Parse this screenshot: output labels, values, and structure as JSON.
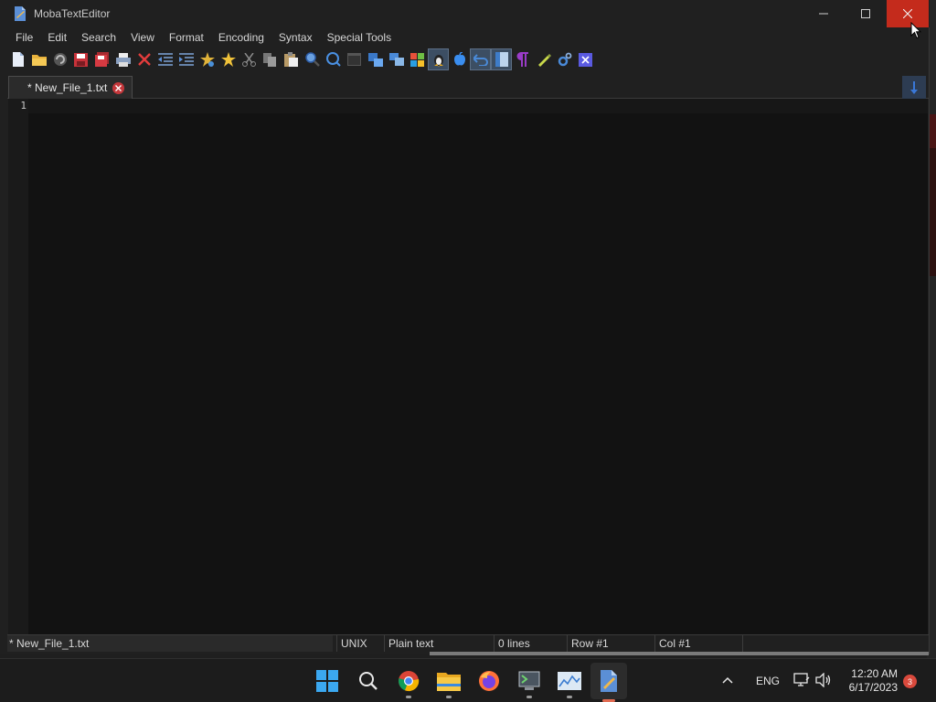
{
  "window": {
    "title": "MobaTextEditor",
    "minimize_icon": "minimize-icon",
    "maximize_icon": "maximize-icon",
    "close_icon": "close-icon"
  },
  "menu": [
    "File",
    "Edit",
    "Search",
    "View",
    "Format",
    "Encoding",
    "Syntax",
    "Special Tools"
  ],
  "toolbar": {
    "icons": [
      "new-file-icon",
      "open-folder-icon",
      "reload-icon",
      "save-icon",
      "save-all-icon",
      "print-icon",
      "close-file-icon",
      "unindent-icon",
      "indent-icon",
      "bookmark-icon",
      "favorite-icon",
      "cut-icon",
      "copy-icon",
      "paste-icon",
      "find-icon",
      "replace-icon",
      "terminal-icon",
      "compare-icon",
      "multi-window-icon",
      "windows-icon",
      "linux-icon",
      "apple-icon",
      "undo-icon",
      "panel-icon",
      "pilcrow-icon",
      "highlight-icon",
      "settings-icon",
      "exit-icon"
    ]
  },
  "tabs": [
    {
      "label": "* New_File_1.txt",
      "close_icon": "tab-close-icon"
    }
  ],
  "editor": {
    "line_numbers": [
      "1"
    ]
  },
  "status": {
    "file": "* New_File_1.txt",
    "line_ending": "UNIX",
    "syntax": "Plain text",
    "lines": "0 lines",
    "row": "Row #1",
    "col": "Col #1"
  },
  "taskbar": {
    "apps": [
      "start-icon",
      "search-icon",
      "chrome-icon",
      "file-explorer-icon",
      "firefox-icon",
      "terminal-icon",
      "chart-app-icon",
      "mobatexteditor-icon"
    ],
    "tray": {
      "language": "ENG",
      "time": "12:20 AM",
      "date": "6/17/2023",
      "notifications": "3"
    }
  },
  "colors": {
    "titlebar": "#202020",
    "editor_bg": "#121212",
    "close_hover": "#c42b1c",
    "accent": "#e26b52"
  }
}
